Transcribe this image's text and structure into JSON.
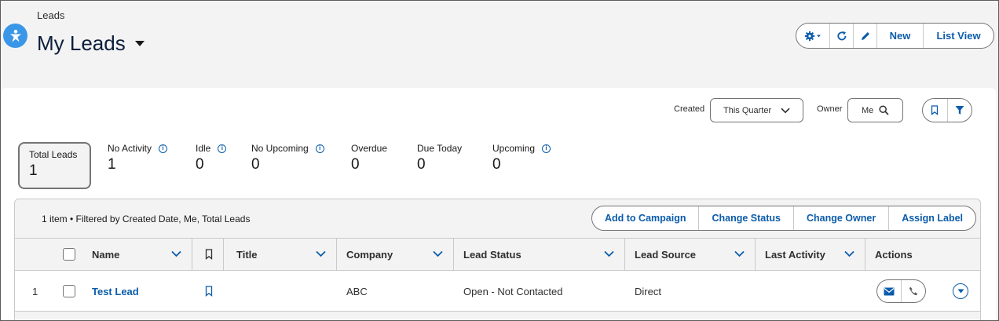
{
  "header": {
    "breadcrumb": "Leads",
    "title": "My Leads",
    "buttons": {
      "new": "New",
      "list_view": "List View"
    }
  },
  "filters": {
    "created_label": "Created",
    "created_value": "This Quarter",
    "owner_label": "Owner",
    "owner_value": "Me"
  },
  "metrics": [
    {
      "label": "Total Leads",
      "value": "1",
      "info": false,
      "selected": true
    },
    {
      "label": "No Activity",
      "value": "1",
      "info": true
    },
    {
      "label": "Idle",
      "value": "0",
      "info": true
    },
    {
      "label": "No Upcoming",
      "value": "0",
      "info": true
    },
    {
      "label": "Overdue",
      "value": "0",
      "info": false
    },
    {
      "label": "Due Today",
      "value": "0",
      "info": false
    },
    {
      "label": "Upcoming",
      "value": "0",
      "info": true
    }
  ],
  "list": {
    "meta": "1 item • Filtered by Created Date, Me, Total Leads",
    "actions": [
      "Add to Campaign",
      "Change Status",
      "Change Owner",
      "Assign Label"
    ],
    "columns": {
      "name": "Name",
      "title": "Title",
      "company": "Company",
      "lead_status": "Lead Status",
      "lead_source": "Lead Source",
      "last_activity": "Last Activity",
      "actions": "Actions"
    },
    "rows": [
      {
        "index": "1",
        "name": "Test Lead",
        "title": "",
        "company": "ABC",
        "lead_status": "Open - Not Contacted",
        "lead_source": "Direct",
        "last_activity": ""
      }
    ]
  },
  "colors": {
    "brand": "#0b5cab",
    "app_icon": "#3a97e8",
    "background": "#f3f3f3"
  }
}
